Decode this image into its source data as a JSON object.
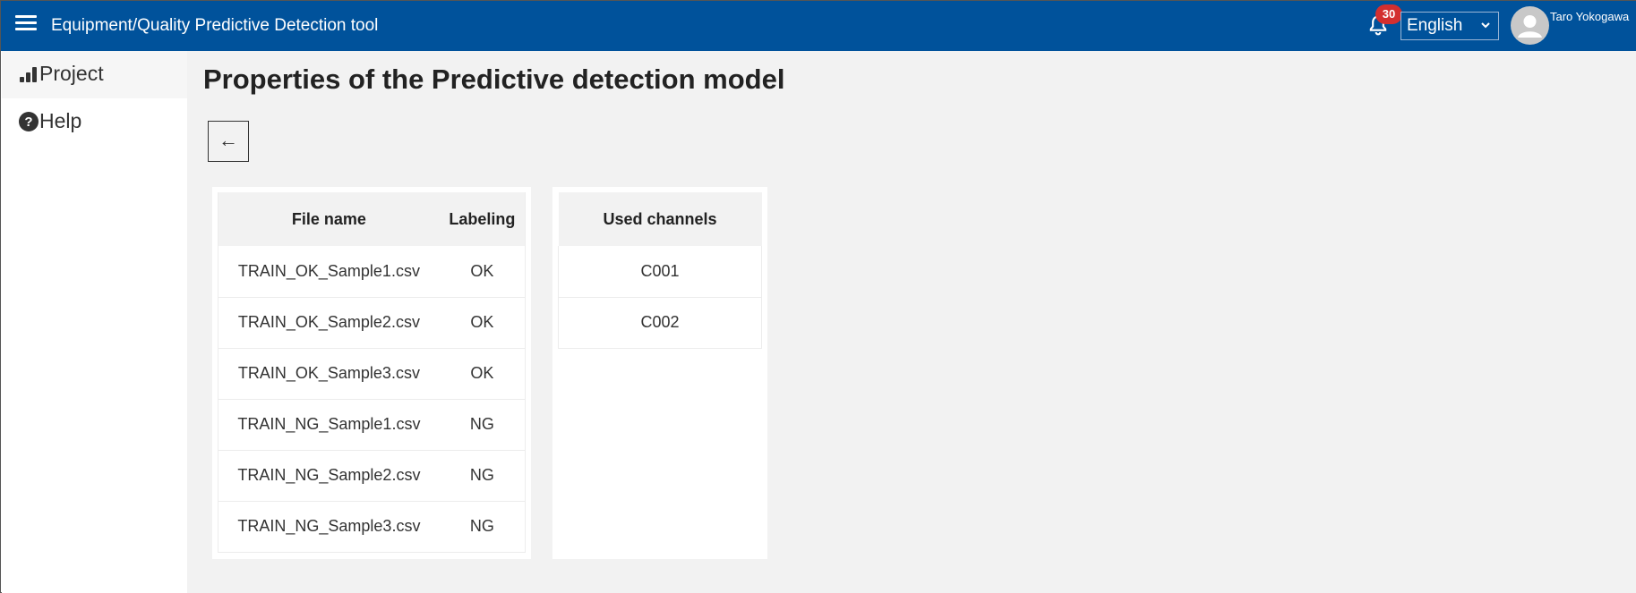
{
  "header": {
    "title": "Equipment/Quality Predictive Detection tool",
    "notification_count": "30",
    "language": "English",
    "user_name": "Taro Yokogawa"
  },
  "sidebar": {
    "items": [
      {
        "label": "Project",
        "icon": "bar-chart-icon",
        "active": true
      },
      {
        "label": "Help",
        "icon": "help-circle-icon",
        "active": false
      }
    ]
  },
  "main": {
    "page_title": "Properties of the Predictive detection model",
    "back_label": "←",
    "files_table": {
      "headers": [
        "File name",
        "Labeling"
      ],
      "rows": [
        [
          "TRAIN_OK_Sample1.csv",
          "OK"
        ],
        [
          "TRAIN_OK_Sample2.csv",
          "OK"
        ],
        [
          "TRAIN_OK_Sample3.csv",
          "OK"
        ],
        [
          "TRAIN_NG_Sample1.csv",
          "NG"
        ],
        [
          "TRAIN_NG_Sample2.csv",
          "NG"
        ],
        [
          "TRAIN_NG_Sample3.csv",
          "NG"
        ]
      ]
    },
    "channels_table": {
      "header": "Used channels",
      "rows": [
        "C001",
        "C002"
      ]
    }
  },
  "colors": {
    "topbar": "#00529b",
    "badge": "#d32f2f",
    "main_bg": "#f2f2f2"
  }
}
